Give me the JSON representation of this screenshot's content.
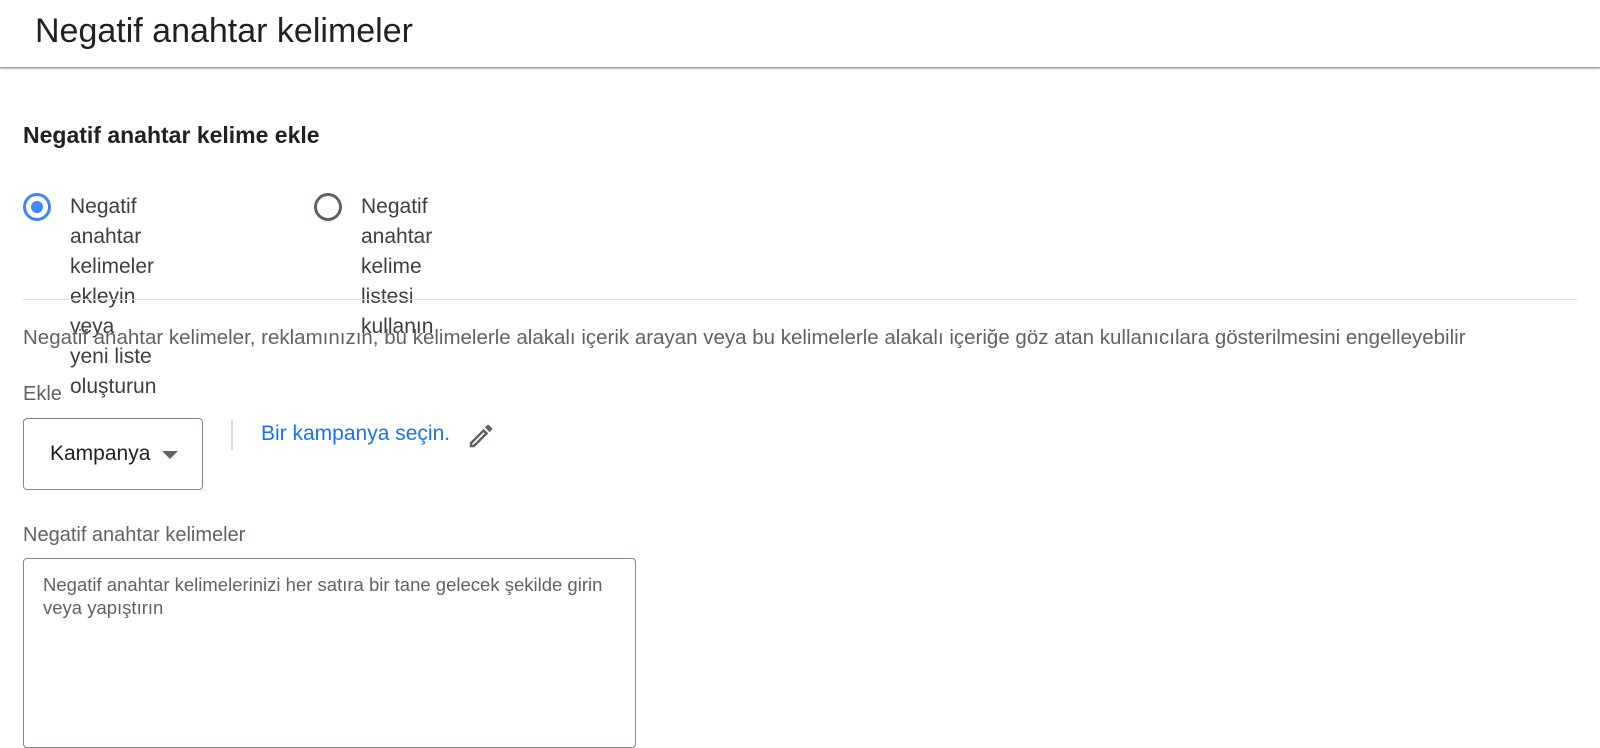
{
  "header": {
    "title": "Negatif anahtar kelimeler"
  },
  "section": {
    "title": "Negatif anahtar kelime ekle"
  },
  "radio_options": [
    {
      "line1": "Negatif anahtar",
      "line2": "kelimeler ekleyin veya",
      "line3": "yeni liste oluşturun",
      "checked": true
    },
    {
      "line1": "Negatif anahtar kelime",
      "line2": "listesi kullanın",
      "checked": false
    }
  ],
  "description": "Negatif anahtar kelimeler, reklamınızın, bu kelimelerle alakalı içerik arayan veya bu kelimelerle alakalı içeriğe göz atan kullanıcılara gösterilmesini engelleyebilir",
  "add_to": {
    "label": "Ekle",
    "selected_level": "Kampanya",
    "campaign_link": "Bir kampanya seçin."
  },
  "keywords": {
    "label": "Negatif anahtar kelimeler",
    "placeholder": "Negatif anahtar kelimelerinizi her satıra bir tane gelecek şekilde girin veya yapıştırın",
    "value": ""
  },
  "colors": {
    "accent": "#4285f4",
    "link": "#1a73e8"
  },
  "icons": {
    "edit": "pencil-icon",
    "dropdown": "caret-down-icon"
  }
}
